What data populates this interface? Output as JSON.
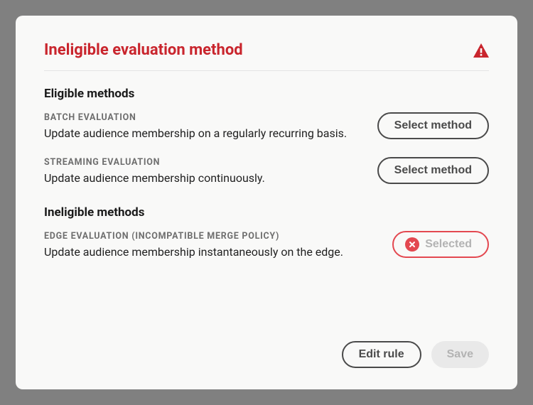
{
  "dialog": {
    "title": "Ineligible evaluation method"
  },
  "eligible": {
    "heading": "Eligible methods",
    "methods": [
      {
        "label": "BATCH EVALUATION",
        "desc": "Update audience membership on a regularly recurring basis.",
        "button": "Select method"
      },
      {
        "label": "STREAMING EVALUATION",
        "desc": "Update audience membership continuously.",
        "button": "Select method"
      }
    ]
  },
  "ineligible": {
    "heading": "Ineligible methods",
    "methods": [
      {
        "label": "EDGE EVALUATION (INCOMPATIBLE MERGE POLICY)",
        "desc": "Update audience membership instantaneously on the edge.",
        "button": "Selected"
      }
    ]
  },
  "footer": {
    "edit_rule": "Edit rule",
    "save": "Save"
  }
}
